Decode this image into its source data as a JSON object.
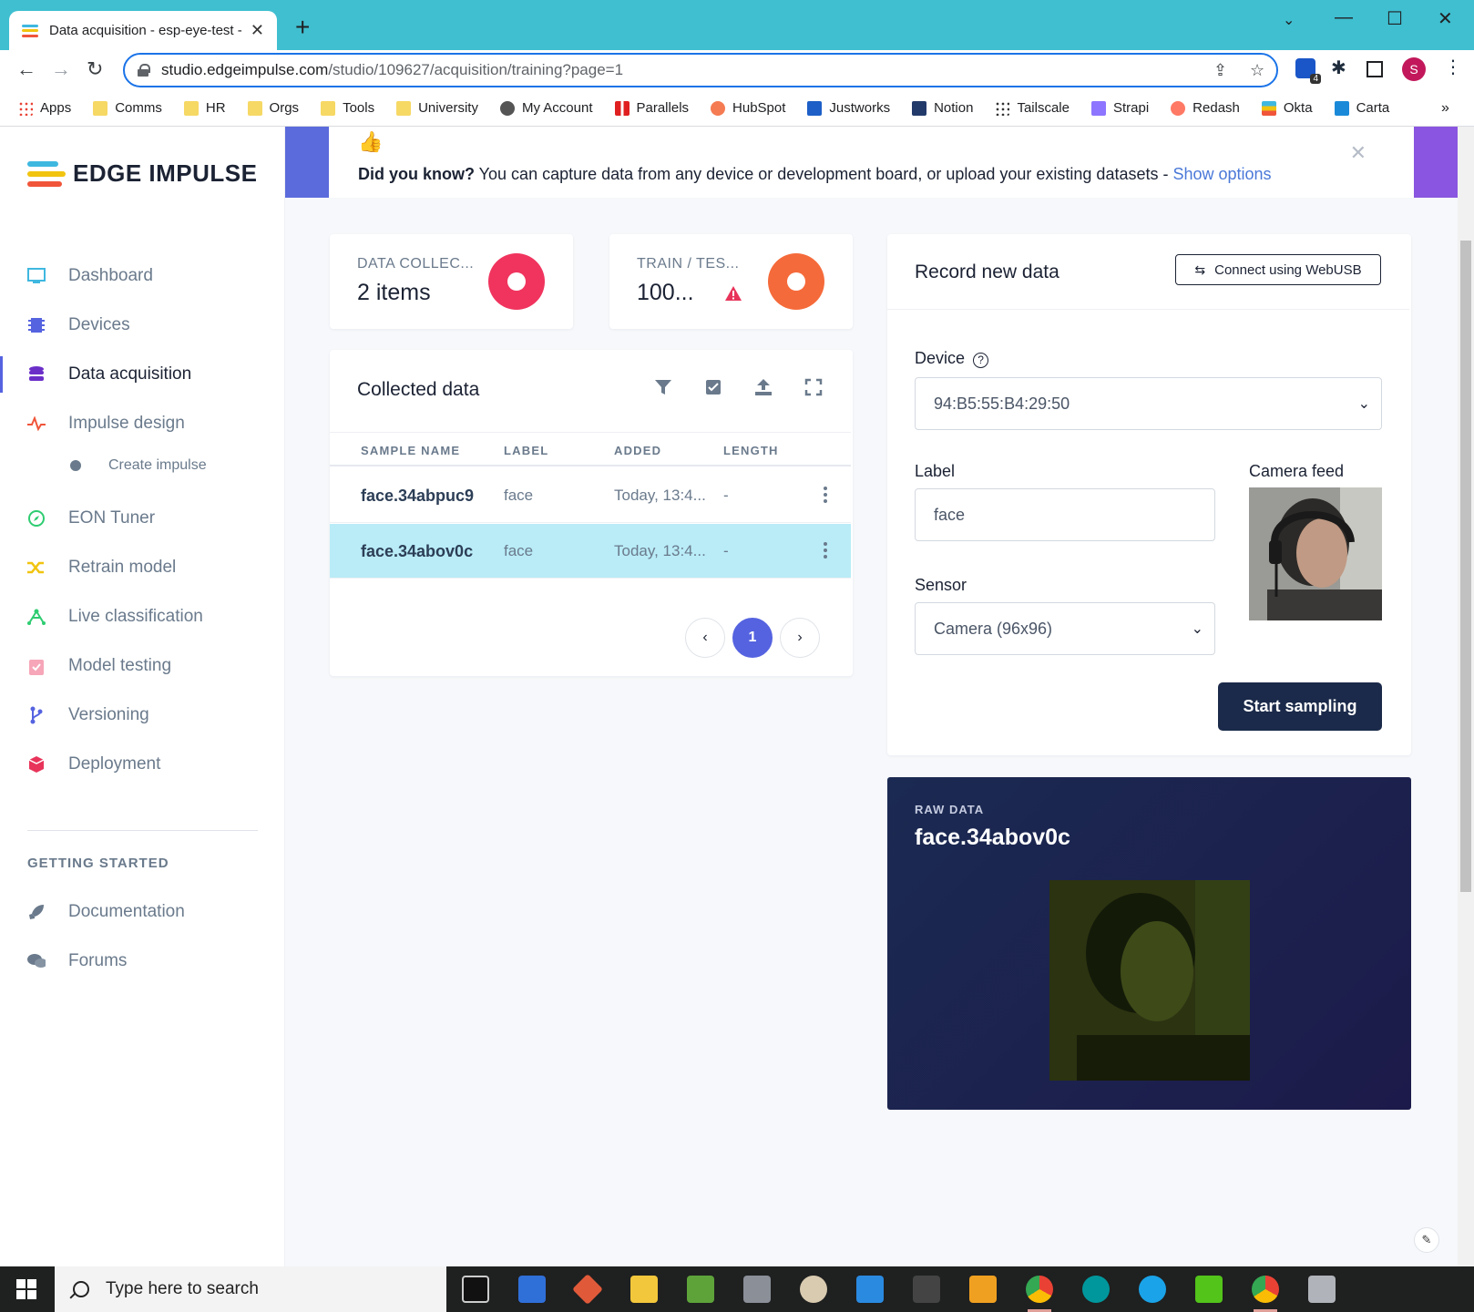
{
  "browser": {
    "tab_title": "Data acquisition - esp-eye-test -",
    "url_domain": "studio.edgeimpulse.com",
    "url_path": "/studio/109627/acquisition/training?page=1",
    "profile_initial": "S",
    "extension_badge": "4"
  },
  "bookmarks": [
    "Apps",
    "Comms",
    "HR",
    "Orgs",
    "Tools",
    "University",
    "My Account",
    "Parallels",
    "HubSpot",
    "Justworks",
    "Notion",
    "Tailscale",
    "Strapi",
    "Redash",
    "Okta",
    "Carta"
  ],
  "sidebar": {
    "logo_text": "EDGE IMPULSE",
    "items": [
      {
        "label": "Dashboard",
        "icon": "monitor-icon",
        "color": "#3fb8e0"
      },
      {
        "label": "Devices",
        "icon": "chip-icon",
        "color": "#5563e0"
      },
      {
        "label": "Data acquisition",
        "icon": "database-icon",
        "color": "#6b2fc8"
      },
      {
        "label": "Impulse design",
        "icon": "pulse-icon",
        "color": "#f0553a"
      },
      {
        "label": "EON Tuner",
        "icon": "compass-icon",
        "color": "#2ecc71"
      },
      {
        "label": "Retrain model",
        "icon": "shuffle-icon",
        "color": "#f1c40f"
      },
      {
        "label": "Live classification",
        "icon": "network-icon",
        "color": "#2ecc71"
      },
      {
        "label": "Model testing",
        "icon": "clipboard-check-icon",
        "color": "#f06a8a"
      },
      {
        "label": "Versioning",
        "icon": "branch-icon",
        "color": "#5563e0"
      },
      {
        "label": "Deployment",
        "icon": "cube-icon",
        "color": "#e8345a"
      }
    ],
    "sub_item": "Create impulse",
    "section_title": "GETTING STARTED",
    "getting_started": [
      {
        "label": "Documentation",
        "icon": "rocket-icon"
      },
      {
        "label": "Forums",
        "icon": "chat-icon"
      }
    ]
  },
  "banner": {
    "bold": "Did you know?",
    "text": " You can capture data from any device or development board, or upload your existing datasets - ",
    "link": "Show options"
  },
  "stats": {
    "data_collected_label": "DATA COLLEC...",
    "data_collected_value": "2 items",
    "train_test_label": "TRAIN / TES...",
    "train_test_value": "100..."
  },
  "collected": {
    "title": "Collected data",
    "columns": [
      "SAMPLE NAME",
      "LABEL",
      "ADDED",
      "LENGTH"
    ],
    "rows": [
      {
        "name": "face.34abpuc9",
        "label": "face",
        "added": "Today, 13:4...",
        "length": "-"
      },
      {
        "name": "face.34abov0c",
        "label": "face",
        "added": "Today, 13:4...",
        "length": "-"
      }
    ],
    "page": "1"
  },
  "record": {
    "title": "Record new data",
    "webusb_label": "Connect using WebUSB",
    "device_label": "Device",
    "device_value": "94:B5:55:B4:29:50",
    "label_label": "Label",
    "label_value": "face",
    "camera_feed_label": "Camera feed",
    "sensor_label": "Sensor",
    "sensor_value": "Camera (96x96)",
    "start_label": "Start sampling"
  },
  "raw": {
    "heading": "RAW DATA",
    "sample_name": "face.34abov0c"
  },
  "taskbar": {
    "search_placeholder": "Type here to search"
  }
}
